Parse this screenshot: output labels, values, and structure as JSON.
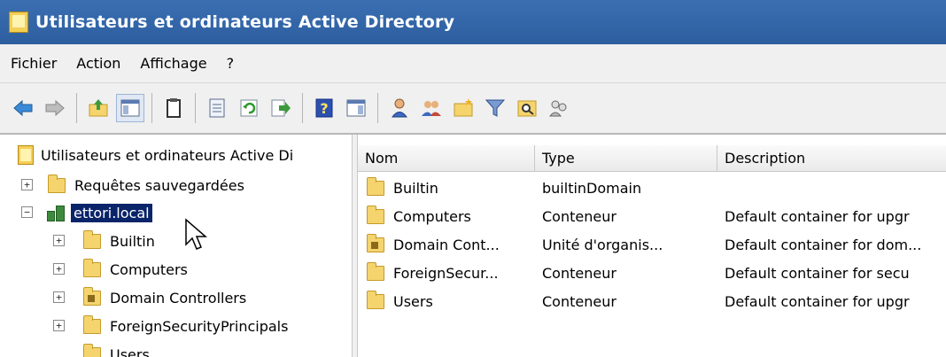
{
  "window": {
    "title": "Utilisateurs et ordinateurs Active Directory",
    "icon": "aduc-app-icon"
  },
  "menu": [
    "Fichier",
    "Action",
    "Affichage",
    "?"
  ],
  "toolbar": [
    "back-arrow-icon",
    "forward-arrow-icon",
    "up-folder-icon",
    "show-console-tree-icon",
    "clipboard-icon",
    "properties-icon",
    "refresh-icon",
    "export-list-icon",
    "help-icon",
    "show-action-pane-icon",
    "new-user-icon",
    "new-group-icon",
    "new-ou-icon",
    "filter-icon",
    "find-icon",
    "add-to-group-icon"
  ],
  "tree": {
    "root": "Utilisateurs et ordinateurs Active Di",
    "saved_queries": "Requêtes sauvegardées",
    "domain": "ettori.local",
    "children": [
      "Builtin",
      "Computers",
      "Domain Controllers",
      "ForeignSecurityPrincipals",
      "Users"
    ]
  },
  "list": {
    "columns": [
      "Nom",
      "Type",
      "Description"
    ],
    "rows": [
      {
        "name": "Builtin",
        "type": "builtinDomain",
        "description": "",
        "icon": "folder-icon"
      },
      {
        "name": "Computers",
        "type": "Conteneur",
        "description": "Default container for upgr",
        "icon": "folder-icon"
      },
      {
        "name": "Domain Cont...",
        "type": "Unité d'organis...",
        "description": "Default container for dom...",
        "icon": "ou-folder-icon"
      },
      {
        "name": "ForeignSecur...",
        "type": "Conteneur",
        "description": "Default container for secu",
        "icon": "folder-icon"
      },
      {
        "name": "Users",
        "type": "Conteneur",
        "description": "Default container for upgr",
        "icon": "folder-icon"
      }
    ]
  },
  "colors": {
    "title_bar": "#2d5e9f",
    "selection": "#0a246a",
    "folder": "#f5d46e"
  }
}
